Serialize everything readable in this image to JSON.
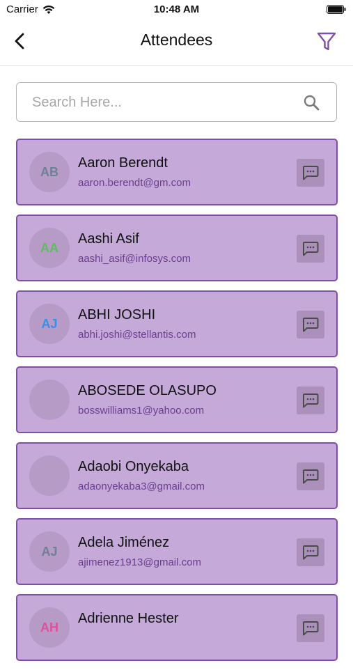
{
  "status_bar": {
    "carrier": "Carrier",
    "time": "10:48 AM"
  },
  "header": {
    "title": "Attendees"
  },
  "search": {
    "placeholder": "Search Here...",
    "value": ""
  },
  "colors": {
    "accent": "#7f4fa3",
    "card_bg": "#c5a9d8",
    "card_border": "#7f4fa3",
    "email_text": "#6b3e8f"
  },
  "attendees": [
    {
      "initials": "AB",
      "initials_color": "#6f7f95",
      "name": "Aaron Berendt",
      "email": "aaron.berendt@gm.com"
    },
    {
      "initials": "AA",
      "initials_color": "#5cbf5c",
      "name": "Aashi Asif",
      "email": "aashi_asif@infosys.com"
    },
    {
      "initials": "AJ",
      "initials_color": "#3a8ee8",
      "name": "ABHI JOSHI",
      "email": "abhi.joshi@stellantis.com"
    },
    {
      "initials": "",
      "initials_color": "#6f7f95",
      "name": "ABOSEDE OLASUPO",
      "email": "bosswilliams1@yahoo.com"
    },
    {
      "initials": "",
      "initials_color": "#6f7f95",
      "name": "Adaobi Onyekaba",
      "email": "adaonyekaba3@gmail.com"
    },
    {
      "initials": "AJ",
      "initials_color": "#6f7f95",
      "name": "Adela Jiménez",
      "email": "ajimenez1913@gmail.com"
    },
    {
      "initials": "AH",
      "initials_color": "#e0519b",
      "name": "Adrienne Hester",
      "email": ""
    }
  ]
}
